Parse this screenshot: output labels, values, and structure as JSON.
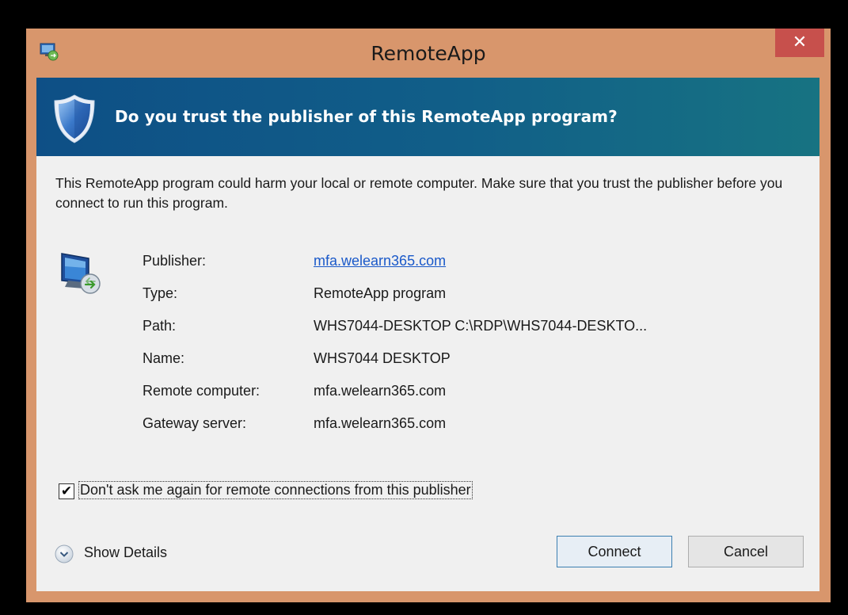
{
  "window": {
    "title": "RemoteApp",
    "close_label": "✕"
  },
  "banner": {
    "heading": "Do you trust the publisher of this RemoteApp program?"
  },
  "message": "This RemoteApp program could harm your local or remote computer. Make sure that you trust the publisher before you connect to run this program.",
  "details": {
    "publisher": {
      "label": "Publisher:",
      "value": "mfa.welearn365.com"
    },
    "type": {
      "label": "Type:",
      "value": "RemoteApp program"
    },
    "path": {
      "label": "Path:",
      "value": "WHS7044-DESKTOP C:\\RDP\\WHS7044-DESKTO..."
    },
    "name": {
      "label": "Name:",
      "value": "WHS7044 DESKTOP"
    },
    "remote_computer": {
      "label": "Remote computer:",
      "value": "mfa.welearn365.com"
    },
    "gateway_server": {
      "label": "Gateway server:",
      "value": "mfa.welearn365.com"
    }
  },
  "checkbox": {
    "checked": true,
    "mark": "✔",
    "label": "Don't ask me again for remote connections from this publisher"
  },
  "show_details": {
    "label": "Show Details"
  },
  "buttons": {
    "connect": "Connect",
    "cancel": "Cancel"
  },
  "colors": {
    "frame": "#d8966c",
    "banner_start": "#0e4f86",
    "banner_end": "#177382",
    "close": "#c7504c",
    "link": "#1a59c9"
  },
  "icons": {
    "app": "remoteapp-icon",
    "shield": "shield-icon",
    "computer": "remote-computer-icon",
    "expand": "chevron-down-icon"
  }
}
